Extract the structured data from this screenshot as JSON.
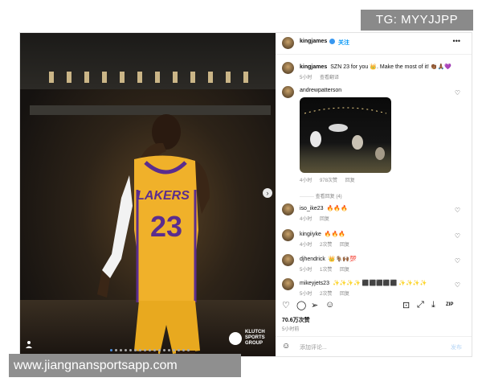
{
  "watermark_top": "TG: MYYJJPP",
  "watermark_bottom": "www.jiangnansportsapp.com",
  "post": {
    "username": "kingjames",
    "follow_label": "关注",
    "more_icon": "more-icon",
    "caption": "SZN 23 for you 👑. Make the most of it! 👏🏾🙏🏾💜",
    "caption_time": "5小时",
    "caption_action": "查看翻译",
    "photo_logo": "KLUTCH SPORTS GROUP",
    "jersey_team": "LAKERS",
    "jersey_number": "23",
    "carousel_count": 17,
    "carousel_active": 0
  },
  "comments": [
    {
      "username": "andrewpatterson",
      "text": "",
      "time": "4小时",
      "likes": "978次赞",
      "reply": "回复",
      "has_image": true,
      "view_replies": "查看回复 (4)"
    },
    {
      "username": "iso_ike23",
      "text": "🔥🔥🔥",
      "time": "4小时",
      "likes": "",
      "reply": "回复"
    },
    {
      "username": "kingiiyke",
      "text": "🔥🔥🔥",
      "time": "4小时",
      "likes": "2次赞",
      "reply": "回复"
    },
    {
      "username": "djhendrick",
      "text": "👑🐐🙌🏾💯",
      "time": "5小时",
      "likes": "1次赞",
      "reply": "回复"
    },
    {
      "username": "mikeyjets23",
      "text": "✨✨✨✨ ⬛⬛⬛⬛⬛ ✨✨✨✨",
      "time": "5小时",
      "likes": "2次赞",
      "reply": "回复"
    }
  ],
  "actions": {
    "like_icon": "heart-icon",
    "comment_icon": "comment-icon",
    "share_icon": "send-icon",
    "extra_icon": "emoji-icon",
    "save_icon": "bookmark-icon",
    "expand_icon": "expand-icon",
    "download_icon": "download-icon",
    "zip_label": "ZIP"
  },
  "likes_count": "70.6万次赞",
  "post_date": "5小时前",
  "composer": {
    "placeholder": "添加评论...",
    "send_label": "发布"
  }
}
